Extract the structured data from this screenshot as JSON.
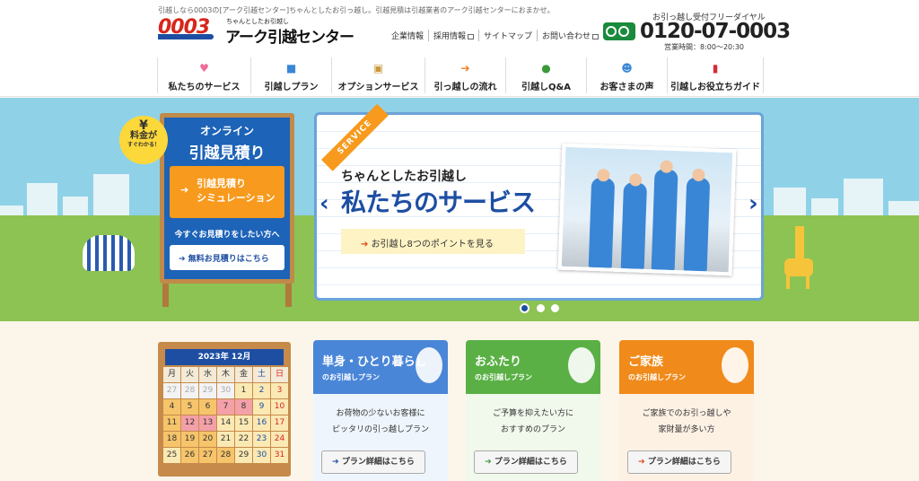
{
  "header": {
    "tagline": "引越しなら0003の[アーク引越センター]ちゃんとしたお引っ越し。引越見積は引越業者のアーク引越センターにおまかせ。",
    "logo_number": "0003",
    "logo_sub": "ちゃんとしたお引越し",
    "logo_name": "アーク引越センター",
    "links": [
      "企業情報",
      "採用情報",
      "サイトマップ",
      "お問い合わせ"
    ],
    "phone_label": "お引っ越し受付フリーダイヤル",
    "phone_number": "0120-07-0003",
    "hours": "営業時間：8:00〜20:30"
  },
  "nav": {
    "items": [
      {
        "label": "私たちのサービス",
        "icon": "heart-icon",
        "color": "#f06a9a"
      },
      {
        "label": "引越しプラン",
        "icon": "truck-icon",
        "color": "#3a86d6"
      },
      {
        "label": "オプションサービス",
        "icon": "box-icon",
        "color": "#c8973c"
      },
      {
        "label": "引っ越しの流れ",
        "icon": "flow-arrow-icon",
        "color": "#f07a1a"
      },
      {
        "label": "引越しQ&A",
        "icon": "question-icon",
        "color": "#3a9a3a"
      },
      {
        "label": "お客さまの声",
        "icon": "people-icon",
        "color": "#3a86d6"
      },
      {
        "label": "引越しお役立ちガイド",
        "icon": "book-icon",
        "color": "#d72a3a"
      }
    ]
  },
  "board": {
    "badge_symbol": "¥",
    "badge_line1": "料金が",
    "badge_line2": "すぐわかる！",
    "title1": "オンライン",
    "title2": "引越見積り",
    "sim_line1": "引越見積り",
    "sim_line2": "シミュレーション",
    "prompt": "今すぐお見積りをしたい方へ",
    "free_button": "無料お見積りはこちら"
  },
  "slide": {
    "ribbon": "SERVICE",
    "subtitle": "ちゃんとしたお引越し",
    "title": "私たちのサービス",
    "button": "お引越し8つのポイントを見る",
    "prev": "‹",
    "next": "›"
  },
  "calendar": {
    "title": "2023年 12月",
    "weekdays": [
      "月",
      "火",
      "水",
      "木",
      "金",
      "土",
      "日"
    ],
    "days": [
      "27",
      "28",
      "29",
      "30",
      "1",
      "2",
      "3",
      "4",
      "5",
      "6",
      "7",
      "8",
      "9",
      "10",
      "11",
      "12",
      "13",
      "14",
      "15",
      "16",
      "17",
      "18",
      "19",
      "20",
      "21",
      "22",
      "23",
      "24",
      "25",
      "26",
      "27",
      "28",
      "29",
      "30",
      "31"
    ]
  },
  "plans": [
    {
      "title": "単身・ひとり暮らし",
      "sub": "のお引越しプラン",
      "line1": "お荷物の少ないお客様に",
      "line2": "ピッタリの引っ越しプラン",
      "button": "プラン詳細はこちら",
      "color": "#4a86d8"
    },
    {
      "title": "おふたり",
      "sub": "のお引越しプラン",
      "line1": "ご予算を抑えたい方に",
      "line2": "おすすめのプラン",
      "button": "プラン詳細はこちら",
      "color": "#5ab045"
    },
    {
      "title": "ご家族",
      "sub": "のお引越しプラン",
      "line1": "ご家族でのお引っ越しや",
      "line2": "家財量が多い方",
      "button": "プラン詳細はこちら",
      "color": "#f08a1a"
    }
  ]
}
